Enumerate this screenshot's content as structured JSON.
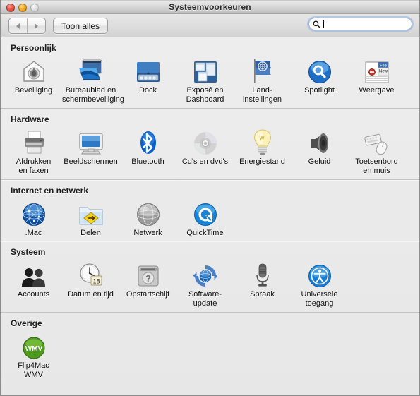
{
  "window": {
    "title": "Systeemvoorkeuren",
    "traffic_lights": [
      "close-button",
      "minimize-button",
      "zoom-button"
    ]
  },
  "toolbar": {
    "back_label": "back-arrow",
    "forward_label": "forward-arrow",
    "show_all_label": "Toon alles",
    "search": {
      "value": "",
      "placeholder": ""
    }
  },
  "sections": [
    {
      "title": "Persoonlijk",
      "items": [
        {
          "label": "Beveiliging",
          "icon": "security-icon"
        },
        {
          "label": "Bureaublad en\nschermbeveiliging",
          "icon": "desktop-screensaver-icon"
        },
        {
          "label": "Dock",
          "icon": "dock-icon"
        },
        {
          "label": "Exposé en\nDashboard",
          "icon": "expose-dashboard-icon"
        },
        {
          "label": "Land-\ninstellingen",
          "icon": "international-flag-icon"
        },
        {
          "label": "Spotlight",
          "icon": "spotlight-icon"
        },
        {
          "label": "Weergave",
          "icon": "appearance-icon"
        }
      ]
    },
    {
      "title": "Hardware",
      "items": [
        {
          "label": "Afdrukken\nen faxen",
          "icon": "printer-fax-icon"
        },
        {
          "label": "Beeldschermen",
          "icon": "displays-icon"
        },
        {
          "label": "Bluetooth",
          "icon": "bluetooth-icon"
        },
        {
          "label": "Cd's en dvd's",
          "icon": "cd-dvd-icon"
        },
        {
          "label": "Energiestand",
          "icon": "energy-saver-icon"
        },
        {
          "label": "Geluid",
          "icon": "sound-speaker-icon"
        },
        {
          "label": "Toetsenbord\nen muis",
          "icon": "keyboard-mouse-icon"
        }
      ]
    },
    {
      "title": "Internet en netwerk",
      "items": [
        {
          "label": ".Mac",
          "icon": "dotmac-globe-icon"
        },
        {
          "label": "Delen",
          "icon": "sharing-folder-icon"
        },
        {
          "label": "Netwerk",
          "icon": "network-globe-icon"
        },
        {
          "label": "QuickTime",
          "icon": "quicktime-icon"
        }
      ]
    },
    {
      "title": "Systeem",
      "items": [
        {
          "label": "Accounts",
          "icon": "accounts-users-icon"
        },
        {
          "label": "Datum en tijd",
          "icon": "date-time-clock-icon"
        },
        {
          "label": "Opstartschijf",
          "icon": "startup-disk-icon"
        },
        {
          "label": "Software-\nupdate",
          "icon": "software-update-icon"
        },
        {
          "label": "Spraak",
          "icon": "speech-microphone-icon"
        },
        {
          "label": "Universele\ntoegang",
          "icon": "universal-access-icon"
        }
      ]
    },
    {
      "title": "Overige",
      "items": [
        {
          "label": "Flip4Mac\nWMV",
          "icon": "flip4mac-wmv-icon"
        }
      ]
    }
  ],
  "colors": {
    "window_bg": "#e8e8e8",
    "content_bg": "#ededed",
    "title_text": "#2b2b2b",
    "divider": "#c3c3c3",
    "search_focus_ring": "#8db3e2",
    "accent_blue": "#1d7fd4",
    "wmv_green": "#4e9a1e"
  }
}
